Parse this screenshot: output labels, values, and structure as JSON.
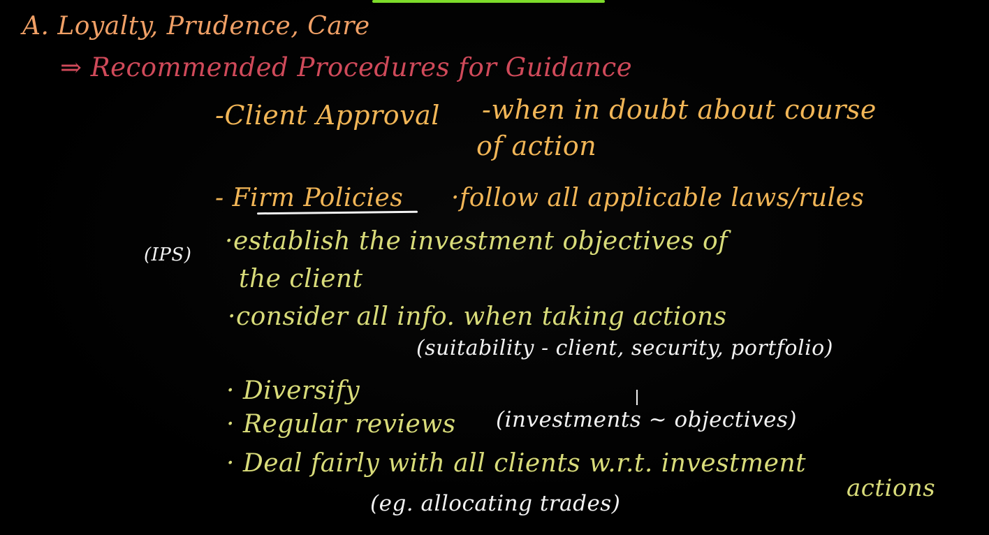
{
  "colors": {
    "orange": "#f0a066",
    "red": "#d04a5a",
    "amber": "#f2b657",
    "yellow": "#d9dc7a",
    "white": "#f2f2f2",
    "green": "#7ddc2a"
  },
  "notes": {
    "heading": "A. Loyalty, Prudence, Care",
    "subheading": "⇒ Recommended Procedures for Guidance",
    "client_approval": {
      "label": "-Client Approval",
      "text": "-when in doubt about course",
      "text_cont": "of action"
    },
    "firm_policies": {
      "label": "- Firm Policies",
      "text": "·follow all applicable laws/rules"
    },
    "ips_tag": "(IPS)",
    "bullets": {
      "establish": "·establish the investment objectives of",
      "establish_cont": "the client",
      "consider": "·consider all info. when taking actions",
      "suitability": "(suitability - client, security, portfolio)",
      "diversify": "· Diversify",
      "regular_reviews": "· Regular reviews",
      "regular_reviews_note": "(investments ~ objectives)",
      "deal_fairly": "· Deal fairly with all clients w.r.t. investment",
      "deal_fairly_cont": "actions",
      "deal_fairly_example": "(eg. allocating trades)"
    }
  }
}
